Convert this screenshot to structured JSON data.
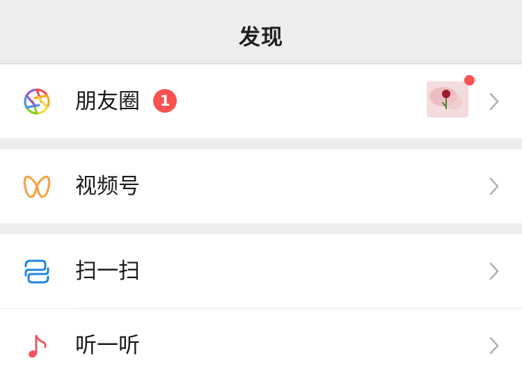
{
  "header": {
    "title": "发现"
  },
  "items": [
    {
      "label": "朋友圈",
      "badge_count": "1",
      "has_thumbnail": true,
      "has_red_dot": true,
      "icon": "moments-icon"
    },
    {
      "label": "视频号",
      "icon": "channels-icon"
    },
    {
      "label": "扫一扫",
      "icon": "scan-icon"
    },
    {
      "label": "听一听",
      "icon": "music-note-icon"
    }
  ],
  "colors": {
    "badge": "#fa5151",
    "channels": "#f5a343",
    "scan": "#1f85e0",
    "music": "#f2545f",
    "chevron": "#b2b2b2"
  }
}
